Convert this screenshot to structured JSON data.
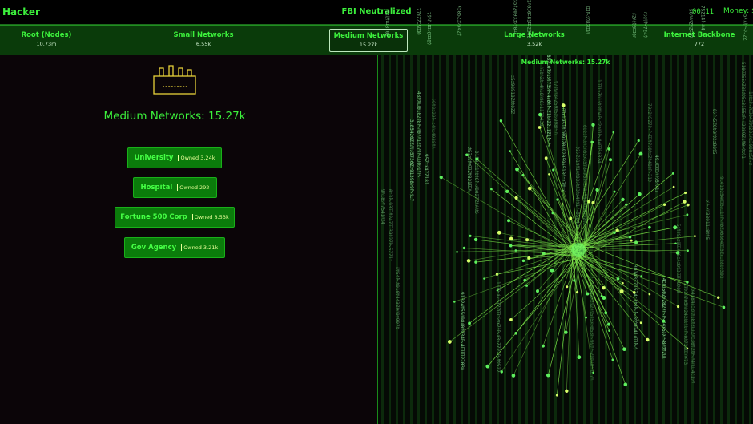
{
  "header": {
    "app_title": "Hacker",
    "status": "FBI Neutralized",
    "timer": "00:11",
    "money_label": "Money: $"
  },
  "tabs": [
    {
      "label": "Root (Nodes)",
      "count": "10.73m",
      "active": false
    },
    {
      "label": "Small Networks",
      "count": "6.55k",
      "active": false
    },
    {
      "label": "Medium Networks",
      "count": "15.27k",
      "active": true
    },
    {
      "label": "Large Networks",
      "count": "3.52k",
      "active": false
    },
    {
      "label": "Internet Backbone",
      "count": "772",
      "active": false
    }
  ],
  "main": {
    "icon": "factory-icon",
    "title": "Medium Networks: 15.27k",
    "networks": [
      {
        "name": "University",
        "owned": "Owned 3.24k"
      },
      {
        "name": "Hospital",
        "owned": "Owned 292"
      },
      {
        "name": "Fortune 500 Corp",
        "owned": "Owned 8.53k"
      },
      {
        "name": "Gov Agency",
        "owned": "Owned 3.21k"
      }
    ]
  },
  "visualization": {
    "title": "Medium Networks: 15.27k",
    "style": "matrix-rain with radial network graph",
    "line_color": "#7fe84a",
    "rain_color": "#9ef0a8"
  },
  "colors": {
    "accent": "#3cf03c",
    "button": "#0b7c0b",
    "owned_text": "#eaff9a",
    "background": "#0b0508"
  }
}
